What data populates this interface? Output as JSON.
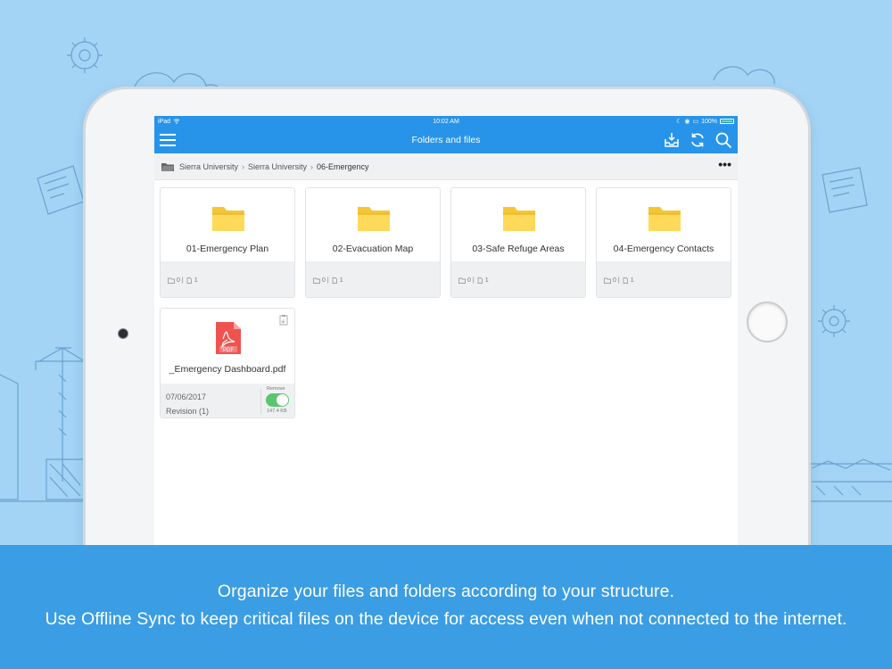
{
  "statusbar": {
    "device": "iPad",
    "time": "10:02 AM",
    "battery": "100%"
  },
  "navbar": {
    "title": "Folders and files"
  },
  "breadcrumb": {
    "items": [
      "Sierra University",
      "Sierra University",
      "06-Emergency"
    ]
  },
  "folders": [
    {
      "name": "01-Emergency Plan",
      "folders": "0",
      "files": "1"
    },
    {
      "name": "02-Evacuation Map",
      "folders": "0",
      "files": "1"
    },
    {
      "name": "03-Safe Refuge Areas",
      "folders": "0",
      "files": "1"
    },
    {
      "name": "04-Emergency Contacts",
      "folders": "0",
      "files": "1"
    }
  ],
  "file": {
    "name": "_Emergency Dashboard.pdf",
    "icon_label": "PDF",
    "date": "07/06/2017",
    "revision": "Revision (1)",
    "toggle_label": "Remove",
    "size": "147.4 KB",
    "offline_enabled": true
  },
  "caption": {
    "line1": "Organize your files and folders according to your structure.",
    "line2": "Use Offline Sync to keep critical files on the device for access even when not connected to the internet."
  },
  "colors": {
    "background": "#a3d4f5",
    "app_bar": "#2794ea",
    "caption_band": "#3b9de3",
    "folder": "#ffd54f",
    "pdf": "#ef5350",
    "toggle_on": "#5cc66e"
  }
}
